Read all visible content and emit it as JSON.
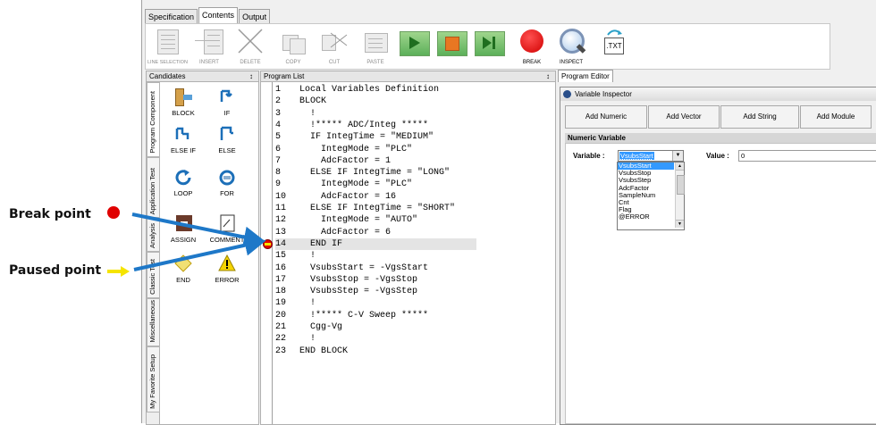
{
  "top_tabs": [
    "Specification",
    "Contents",
    "Output"
  ],
  "toolbar": {
    "buttons": [
      {
        "label": "LINE SELECTION"
      },
      {
        "label": "INSERT"
      },
      {
        "label": "DELETE"
      },
      {
        "label": "COPY"
      },
      {
        "label": "CUT"
      },
      {
        "label": "PASTE"
      },
      {
        "label": ""
      },
      {
        "label": ""
      },
      {
        "label": ""
      },
      {
        "label": "BREAK"
      },
      {
        "label": "INSPECT"
      },
      {
        "label": ""
      }
    ],
    "txt_label": ".TXT",
    "colors": {
      "run": "#4caf50",
      "stop": "#e87722",
      "break": "#e00000"
    }
  },
  "candidates": {
    "title": "Candidates",
    "pin": "↕",
    "vertical_tabs": [
      "Program Component",
      "Application Test",
      "Analysis",
      "Classic Test",
      "Miscellaneous",
      "My Favorite Setup"
    ],
    "components": [
      {
        "label": "BLOCK",
        "icon": "block-icon"
      },
      {
        "label": "IF",
        "icon": "if-icon"
      },
      {
        "label": "ELSE IF",
        "icon": "else-if-icon"
      },
      {
        "label": "ELSE",
        "icon": "else-icon"
      },
      {
        "label": "LOOP",
        "icon": "loop-icon"
      },
      {
        "label": "FOR",
        "icon": "for-icon"
      },
      {
        "label": "ASSIGN",
        "icon": "assign-icon"
      },
      {
        "label": "COMMENT",
        "icon": "comment-icon"
      },
      {
        "label": "END",
        "icon": "end-icon"
      },
      {
        "label": "ERROR",
        "icon": "error-icon"
      }
    ]
  },
  "program_list": {
    "title": "Program List",
    "pin": "↕",
    "highlighted_line": 14,
    "lines": [
      {
        "n": "1",
        "text": "Local Variables Definition"
      },
      {
        "n": "2",
        "text": "BLOCK"
      },
      {
        "n": "3",
        "text": "  !"
      },
      {
        "n": "4",
        "text": "  !***** ADC/Integ *****"
      },
      {
        "n": "5",
        "text": "  IF IntegTime = \"MEDIUM\""
      },
      {
        "n": "6",
        "text": "    IntegMode = \"PLC\""
      },
      {
        "n": "7",
        "text": "    AdcFactor = 1"
      },
      {
        "n": "8",
        "text": "  ELSE IF IntegTime = \"LONG\""
      },
      {
        "n": "9",
        "text": "    IntegMode = \"PLC\""
      },
      {
        "n": "10",
        "text": "    AdcFactor = 16"
      },
      {
        "n": "11",
        "text": "  ELSE IF IntegTime = \"SHORT\""
      },
      {
        "n": "12",
        "text": "    IntegMode = \"AUTO\""
      },
      {
        "n": "13",
        "text": "    AdcFactor = 6"
      },
      {
        "n": "14",
        "text": "  END IF"
      },
      {
        "n": "15",
        "text": "  !"
      },
      {
        "n": "16",
        "text": "  VsubsStart = -VgsStart"
      },
      {
        "n": "17",
        "text": "  VsubsStop = -VgsStop"
      },
      {
        "n": "18",
        "text": "  VsubsStep = -VgsStep"
      },
      {
        "n": "19",
        "text": "  !"
      },
      {
        "n": "20",
        "text": "  !***** C-V Sweep *****"
      },
      {
        "n": "21",
        "text": "  Cgg-Vg"
      },
      {
        "n": "22",
        "text": "  !"
      },
      {
        "n": "23",
        "text": "END BLOCK"
      }
    ]
  },
  "program_editor": {
    "tab": "Program Editor"
  },
  "variable_inspector": {
    "title": "Variable Inspector",
    "buttons": [
      "Add Numeric",
      "Add Vector",
      "Add String",
      "Add Module"
    ],
    "section": "Numeric Variable",
    "variable_label": "Variable :",
    "variable_value": "VsubsStart",
    "value_label": "Value :",
    "value_value": "0",
    "dropdown_options": [
      "VsubsStart",
      "VsubsStop",
      "VsubsStep",
      "AdcFactor",
      "SampleNum",
      "Cnt",
      "Flag",
      "@ERROR"
    ],
    "selected_option": "VsubsStart"
  },
  "annotations": {
    "break_point": "Break point",
    "paused_point": "Paused point",
    "break_color": "#e00000",
    "paused_color": "#f5e400",
    "arrow_color": "#1e78c8"
  }
}
